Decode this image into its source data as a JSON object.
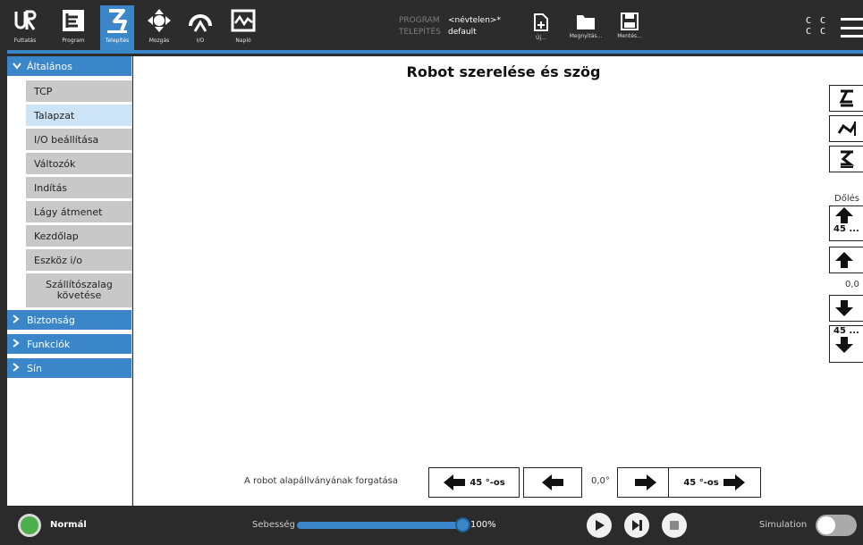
{
  "nav": {
    "items": [
      {
        "label": "Futtatás",
        "icon": "ur-logo-icon"
      },
      {
        "label": "Program",
        "icon": "program-tree-icon"
      },
      {
        "label": "Telepítés",
        "icon": "installation-robot-icon"
      },
      {
        "label": "Mozgás",
        "icon": "move-arrows-icon"
      },
      {
        "label": "I/O",
        "icon": "io-icon"
      },
      {
        "label": "Napló",
        "icon": "log-chart-icon"
      }
    ]
  },
  "program": {
    "program_key": "PROGRAM",
    "program_value": "<névtelen>*",
    "install_key": "TELEPÍTÉS",
    "install_value": "default"
  },
  "file": {
    "new_label": "Új...",
    "open_label": "Megnyitás...",
    "save_label": "Mentés..."
  },
  "cc": {
    "line1": "C C",
    "line2": "C C"
  },
  "sidebar": {
    "sections": [
      {
        "label": "Általános",
        "expanded": true
      },
      {
        "label": "Biztonság",
        "expanded": false
      },
      {
        "label": "Funkciók",
        "expanded": false
      },
      {
        "label": "Sín",
        "expanded": false
      }
    ],
    "items": [
      {
        "label": "TCP",
        "selected": false
      },
      {
        "label": "Talapzat",
        "selected": true
      },
      {
        "label": "I/O beállítása",
        "selected": false
      },
      {
        "label": "Változók",
        "selected": false
      },
      {
        "label": "Indítás",
        "selected": false
      },
      {
        "label": "Lágy átmenet",
        "selected": false
      },
      {
        "label": "Kezdőlap",
        "selected": false
      },
      {
        "label": "Eszköz i/o",
        "selected": false
      },
      {
        "label": "Szállítószalag követése",
        "selected": false
      }
    ]
  },
  "main": {
    "title": "Robot szerelése és szög",
    "tilt_label": "Dőlés",
    "tilt_up45": "45 ...",
    "tilt_value": "0,0",
    "tilt_down45": "45 ...",
    "rotation_label": "A robot alapállványának forgatása",
    "rotate_left45": "45 °-os",
    "rotation_value": "0,0°",
    "rotate_right45": "45 °-os"
  },
  "footer": {
    "status": "Normál",
    "speed_label": "Sebesség",
    "speed_value": "100%",
    "speed_fraction": 1.0,
    "simulation_label": "Simulation"
  },
  "colors": {
    "accent": "#3a86c8",
    "status_ok": "#4cae4c"
  }
}
